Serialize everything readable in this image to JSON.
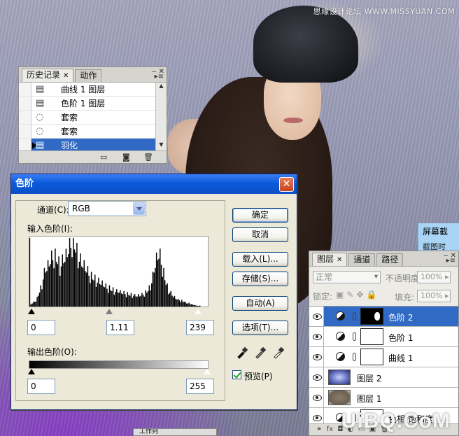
{
  "watermark_top": "思缘设计论坛 WWW.MISSYUAN.COM",
  "watermark_bottom": "UiBQ.CoM",
  "history_panel": {
    "tabs": [
      "历史记录",
      "动作"
    ],
    "items": [
      {
        "icon": "document-layer-icon",
        "label": "曲线 1 图层"
      },
      {
        "icon": "document-layer-icon",
        "label": "色阶 1 图层"
      },
      {
        "icon": "lasso-icon",
        "label": "套索"
      },
      {
        "icon": "lasso-icon",
        "label": "套索"
      },
      {
        "icon": "document-layer-icon",
        "label": "羽化",
        "selected": true
      }
    ]
  },
  "levels_dialog": {
    "title": "色阶",
    "channel_label": "通道(C):",
    "channel_value": "RGB",
    "input_label": "输入色阶(I):",
    "input_black": "0",
    "input_gamma": "1.11",
    "input_white": "239",
    "output_label": "输出色阶(O):",
    "output_black": "0",
    "output_white": "255",
    "buttons": {
      "ok": "确定",
      "cancel": "取消",
      "load": "载入(L)...",
      "save": "存储(S)...",
      "auto": "自动(A)",
      "options": "选项(T)..."
    },
    "preview_label": "预览(P)",
    "preview_checked": true
  },
  "side_panel": {
    "line1": "屏幕截",
    "line2": "截图时"
  },
  "layers_panel": {
    "tabs": [
      "图层",
      "通道",
      "路径"
    ],
    "blend_mode": "正常",
    "opacity_label": "不透明度:",
    "opacity_value": "100%",
    "lock_label": "锁定:",
    "fill_label": "填充:",
    "fill_value": "100%",
    "layers": [
      {
        "name": "色阶 2",
        "type": "adjustment",
        "mask": "black",
        "selected": true
      },
      {
        "name": "色阶 1",
        "type": "adjustment",
        "mask": "white"
      },
      {
        "name": "曲线 1",
        "type": "adjustment",
        "mask": "white"
      },
      {
        "name": "图层 2",
        "type": "pixel"
      },
      {
        "name": "图层 1",
        "type": "pixel"
      },
      {
        "name": "色相/饱和度",
        "type": "adjustment",
        "mask": "white"
      }
    ]
  },
  "bottom_bar_label": "工作列",
  "histogram_data": [
    2,
    3,
    4,
    5,
    6,
    8,
    10,
    14,
    18,
    22,
    28,
    35,
    40,
    44,
    46,
    48,
    52,
    55,
    58,
    60,
    62,
    60,
    58,
    55,
    52,
    50,
    52,
    54,
    56,
    58,
    60,
    64,
    68,
    72,
    76,
    80,
    78,
    74,
    70,
    66,
    62,
    58,
    55,
    52,
    50,
    48,
    46,
    44,
    42,
    40,
    38,
    36,
    35,
    34,
    33,
    32,
    31,
    30,
    29,
    28,
    27,
    26,
    25,
    24,
    23,
    22,
    22,
    21,
    20,
    20,
    19,
    19,
    18,
    18,
    18,
    17,
    17,
    16,
    16,
    16,
    15,
    15,
    15,
    14,
    14,
    14,
    14,
    13,
    13,
    13,
    13,
    13,
    14,
    14,
    15,
    16,
    17,
    18,
    20,
    22,
    26,
    30,
    36,
    44,
    50,
    56,
    60,
    62,
    60,
    54,
    48,
    40,
    34,
    28,
    24,
    20,
    18,
    16,
    14,
    12,
    11,
    10,
    9,
    8,
    8,
    7,
    7,
    6,
    6,
    5,
    5,
    4,
    4,
    3,
    3,
    2,
    2,
    2,
    1,
    1,
    1,
    1,
    0,
    0,
    0,
    0,
    0,
    0
  ]
}
